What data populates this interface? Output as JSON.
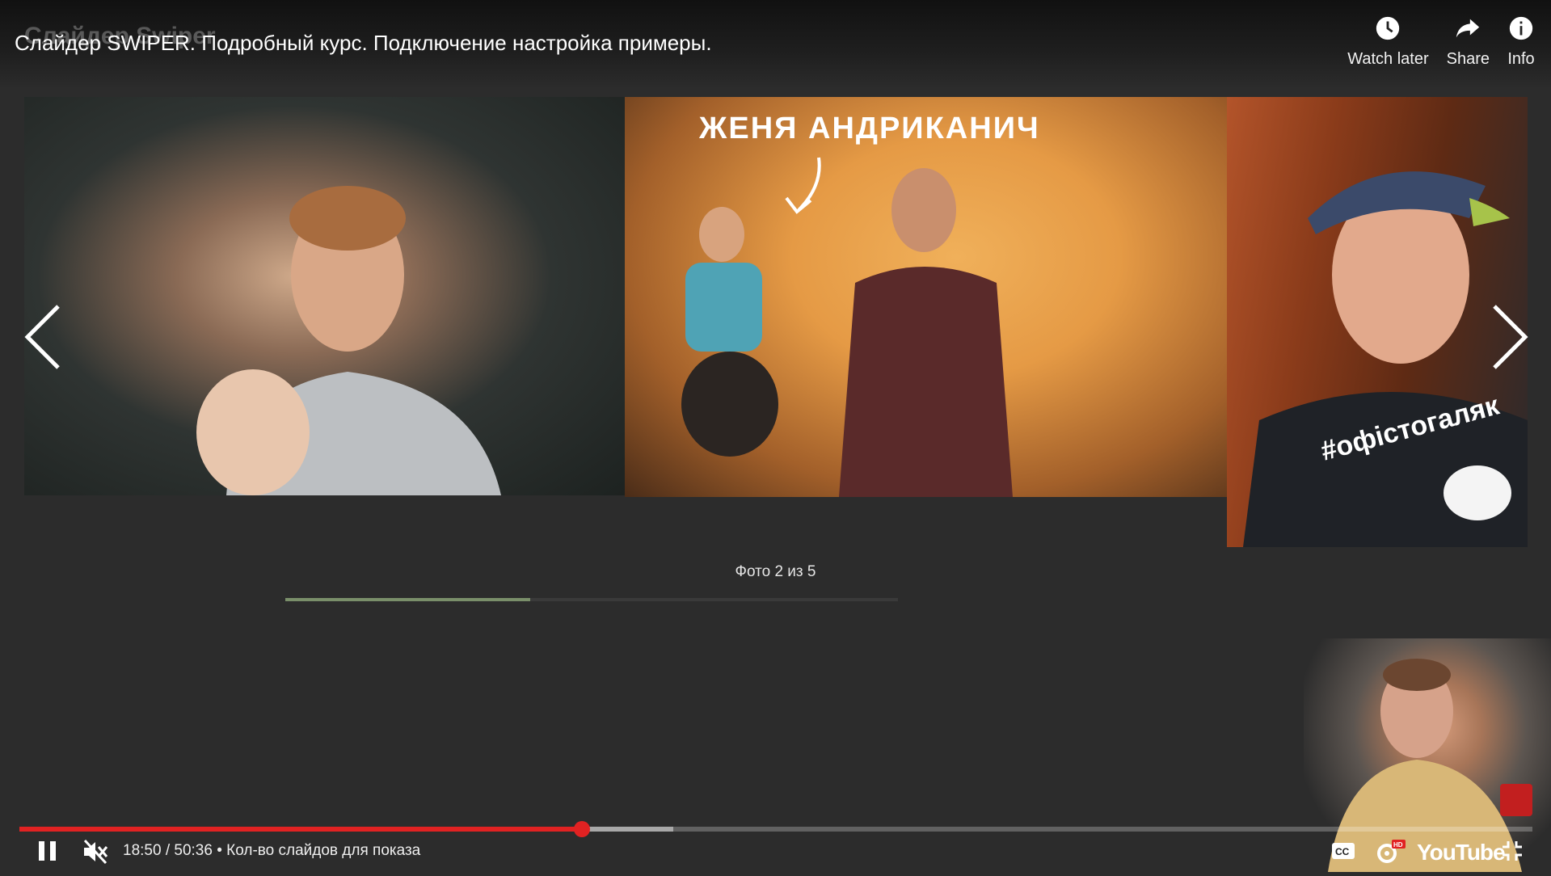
{
  "channel_title": "Слайдер Swiper",
  "video_title": "Слайдер SWIPER. Подробный курс. Подключение настройка примеры.",
  "top_actions": [
    {
      "label": "Watch later",
      "icon": "clock-icon"
    },
    {
      "label": "Share",
      "icon": "share-arrow-icon"
    },
    {
      "label": "Info",
      "icon": "info-icon"
    }
  ],
  "slider": {
    "slides": [
      {
        "subject": "photo-man-with-baby"
      },
      {
        "subject": "photo-man-on-stage",
        "caption": "ЖЕНЯ АНДРИКАНИЧ"
      },
      {
        "subject": "photo-man-in-cap"
      }
    ],
    "counter_text": "Фото 2 из 5",
    "current": 2,
    "total": 5,
    "progress_fraction": 0.4
  },
  "player": {
    "played_fraction": 0.372,
    "current_time": "18:50",
    "duration": "50:36",
    "time_display": "18:50 / 50:36 • Кол-во слайдов для показа",
    "logo_text": "YouTube",
    "accent_color": "#e12222",
    "icons": [
      "pause-icon",
      "mute-icon",
      "captions-icon",
      "settings-hd-icon",
      "exit-fullscreen-icon"
    ]
  }
}
